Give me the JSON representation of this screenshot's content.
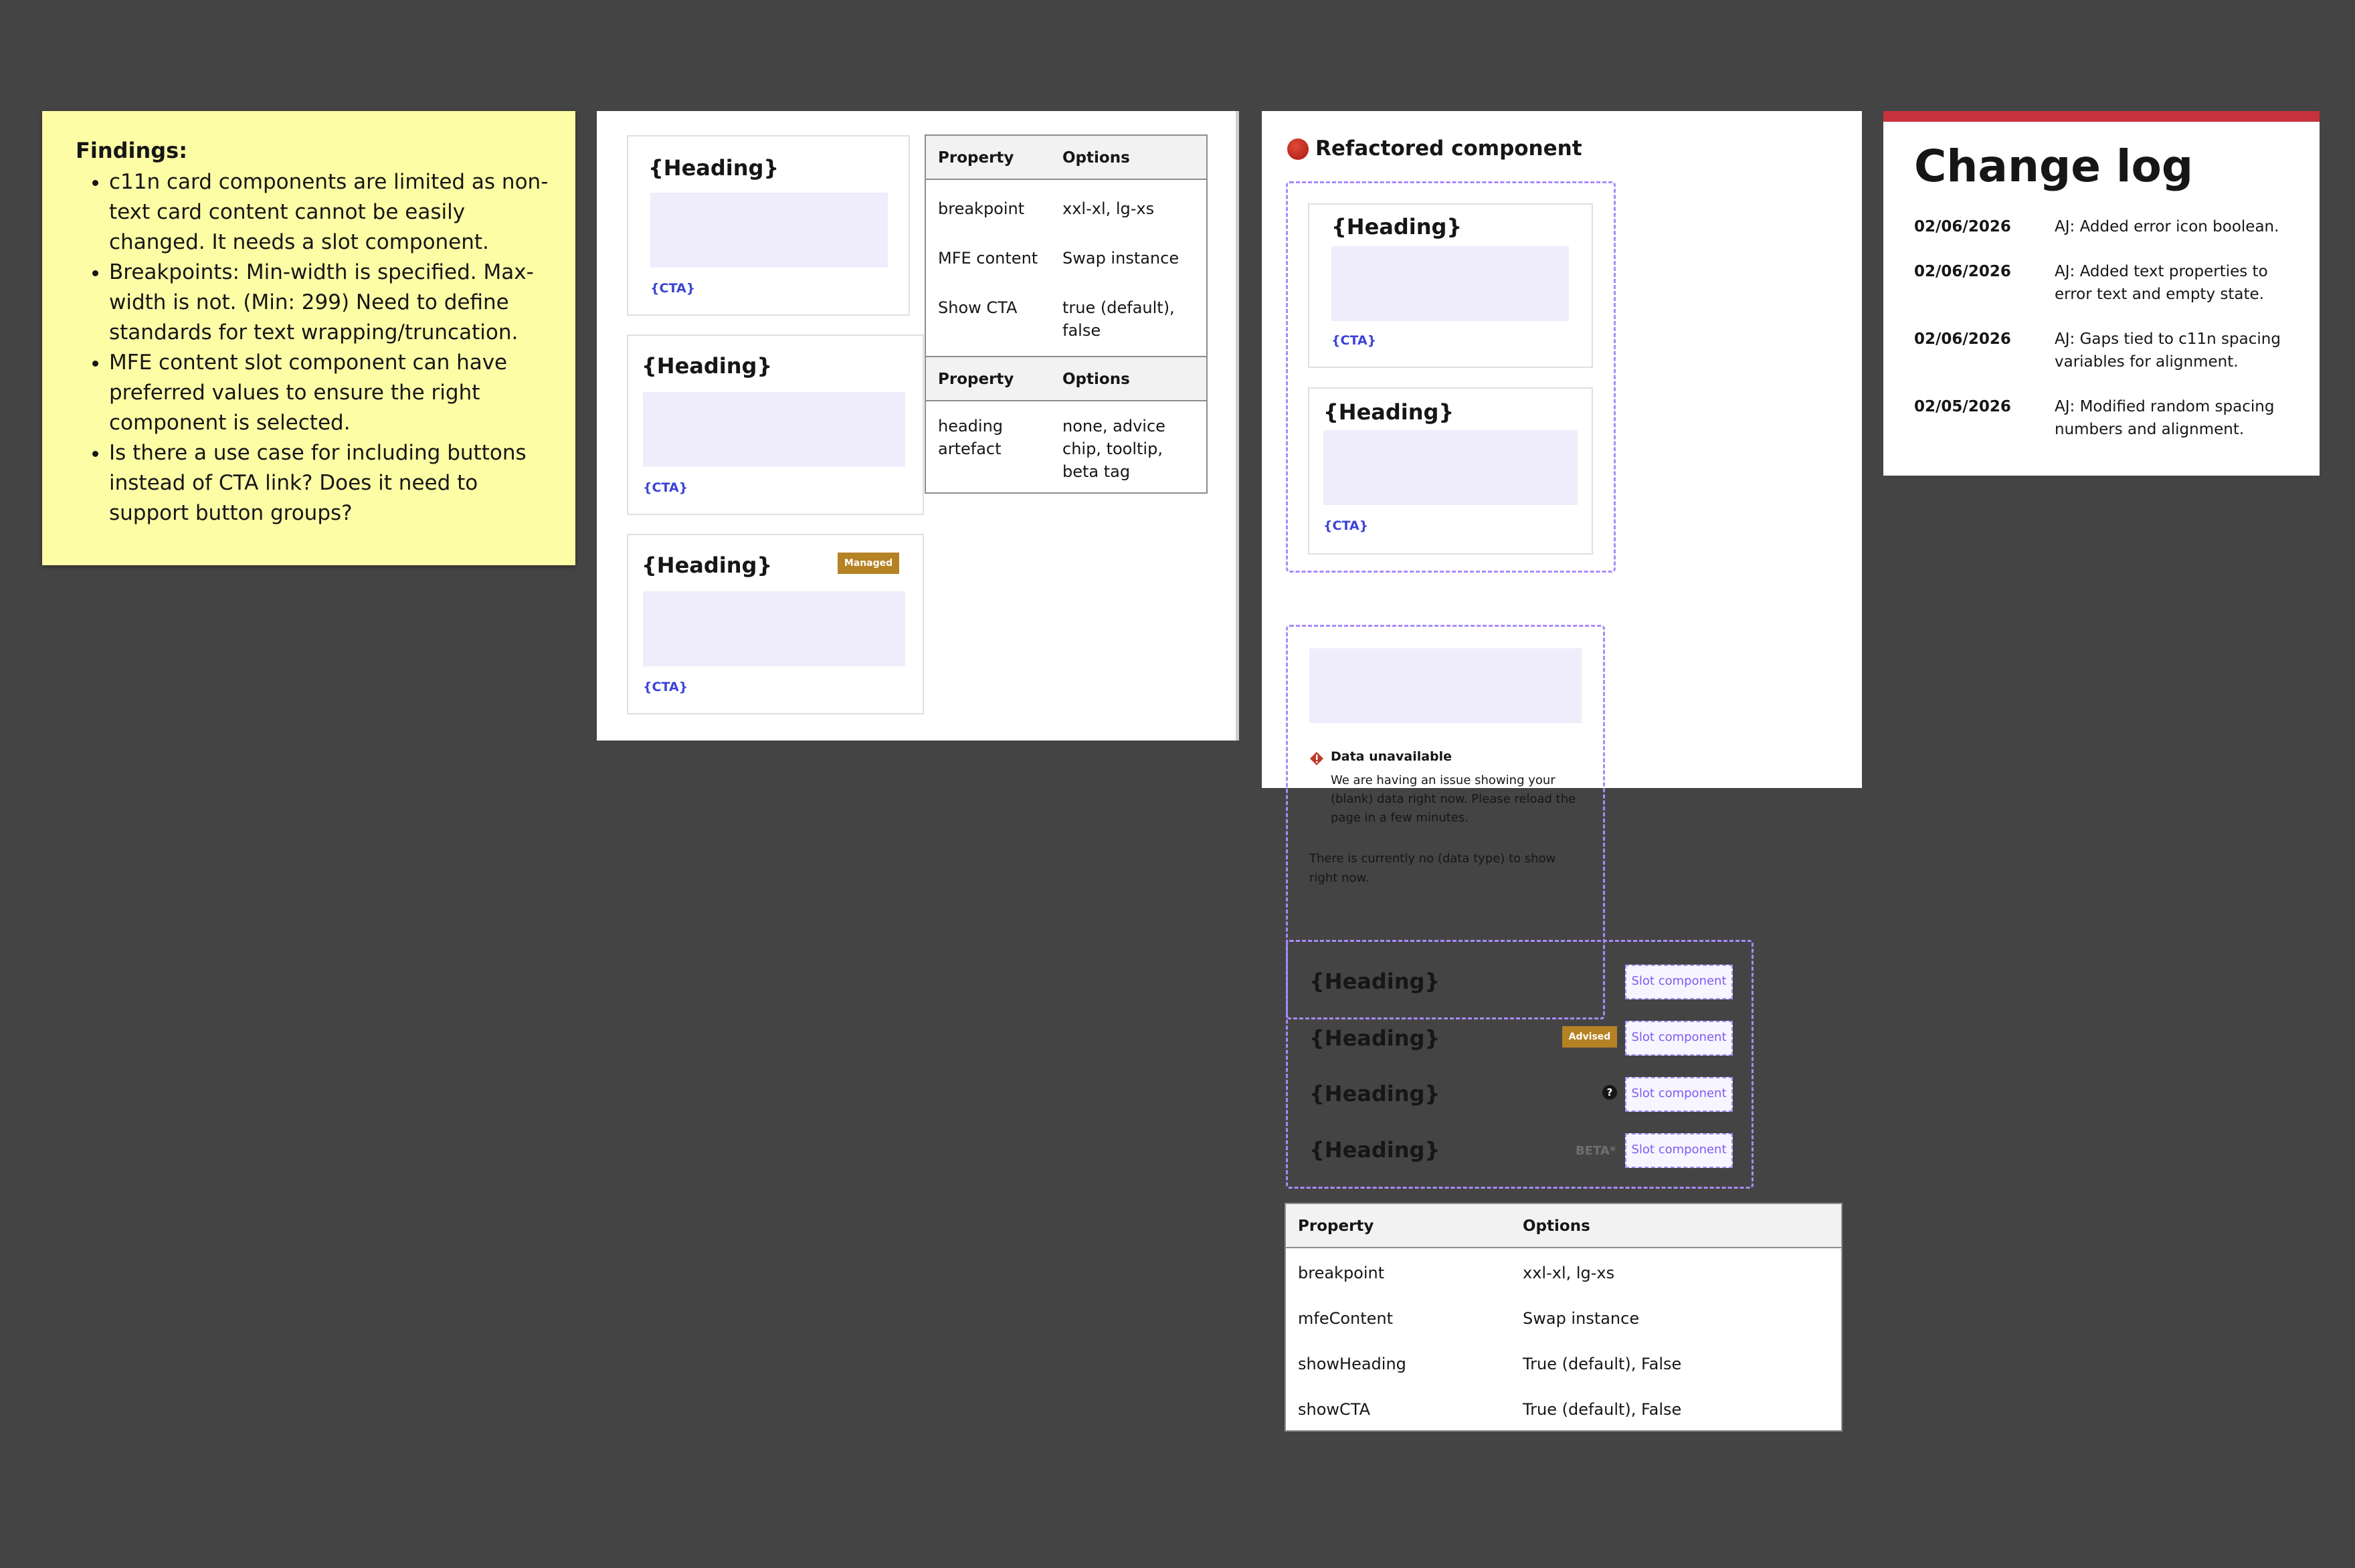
{
  "findings": {
    "title": "Findings:",
    "items": [
      "c11n card components are limited as non-text card content cannot be easily changed. It needs a slot component.",
      "Breakpoints: Min-width is specified. Max-width is not. (Min: 299) Need to define standards for text wrapping/truncation.",
      "MFE content slot component can have preferred values to ensure the right component is selected.",
      "Is there a use case for including buttons instead of CTA link? Does it need to support button groups?"
    ]
  },
  "original": {
    "cards": [
      {
        "heading": "{Heading}",
        "cta": "{CTA}"
      },
      {
        "heading": "{Heading}",
        "cta": "{CTA}"
      },
      {
        "heading": "{Heading}",
        "cta": "{CTA}",
        "tag": "Managed"
      }
    ],
    "table1": {
      "headers": [
        "Property",
        "Options"
      ],
      "rows": [
        [
          "breakpoint",
          "xxl-xl, lg-xs"
        ],
        [
          "MFE content",
          "Swap instance"
        ],
        [
          "Show CTA",
          "true (default), false"
        ]
      ]
    },
    "table2": {
      "headers": [
        "Property",
        "Options"
      ],
      "rows": [
        [
          "heading artefact",
          "none, advice chip, tooltip, beta tag"
        ]
      ]
    }
  },
  "refactored": {
    "title": "Refactored component",
    "cards": [
      {
        "heading": "{Heading}",
        "cta": "{CTA}"
      },
      {
        "heading": "{Heading}",
        "cta": "{CTA}"
      }
    ],
    "error": {
      "title": "Data unavailable",
      "message": "We are having an issue showing your (blank) data right now. Please reload the page in a few minutes.",
      "empty": "There is currently no (data type) to show right now."
    },
    "headings": [
      {
        "heading": "{Heading}",
        "slot": "Slot component"
      },
      {
        "heading": "{Heading}",
        "slot": "Slot component",
        "tag": "Advised"
      },
      {
        "heading": "{Heading}",
        "slot": "Slot component",
        "icon": "?"
      },
      {
        "heading": "{Heading}",
        "slot": "Slot component",
        "beta": "BETA*"
      }
    ],
    "table": {
      "headers": [
        "Property",
        "Options"
      ],
      "rows": [
        [
          "breakpoint",
          "xxl-xl, lg-xs"
        ],
        [
          "mfeContent",
          "Swap instance"
        ],
        [
          "showHeading",
          "True (default), False"
        ],
        [
          "showCTA",
          "True (default), False"
        ]
      ]
    }
  },
  "changelog": {
    "title": "Change log",
    "entries": [
      {
        "date": "02/06/2026",
        "text": "AJ: Added error icon boolean."
      },
      {
        "date": "02/06/2026",
        "text": "AJ: Added text properties to error text and empty state."
      },
      {
        "date": "02/06/2026",
        "text": "AJ: Gaps tied to c11n spacing variables for alignment."
      },
      {
        "date": "02/05/2026",
        "text": "AJ: Modified random spacing numbers and alignment."
      }
    ]
  },
  "colors": {
    "background": "#444444",
    "sticky": "#fdfda6",
    "placeholder": "#efedfb",
    "cta": "#3b43d6",
    "managed_tag": "#b58224",
    "slot_border": "#a78bfa",
    "changelog_accent": "#c8313e",
    "error_icon": "#c0392b"
  }
}
